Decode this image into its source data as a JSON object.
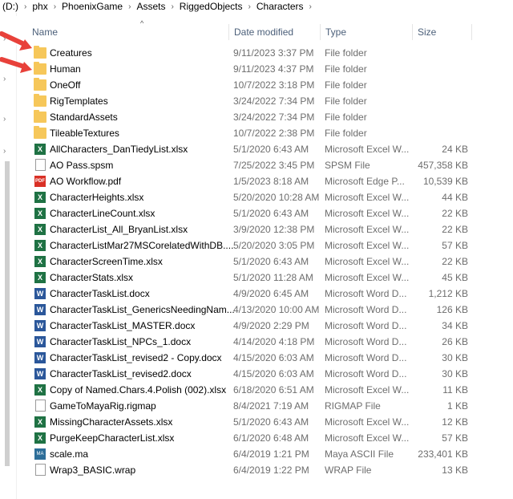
{
  "breadcrumb": [
    "(D:)",
    "phx",
    "PhoenixGame",
    "Assets",
    "RiggedObjects",
    "Characters"
  ],
  "columns": {
    "name": "Name",
    "date": "Date modified",
    "type": "Type",
    "size": "Size"
  },
  "files": [
    {
      "name": "Creatures",
      "date": "9/11/2023 3:37 PM",
      "type": "File folder",
      "size": "",
      "icon": "folder-icon"
    },
    {
      "name": "Human",
      "date": "9/11/2023 4:37 PM",
      "type": "File folder",
      "size": "",
      "icon": "folder-icon"
    },
    {
      "name": "OneOff",
      "date": "10/7/2022 3:18 PM",
      "type": "File folder",
      "size": "",
      "icon": "folder-icon"
    },
    {
      "name": "RigTemplates",
      "date": "3/24/2022 7:34 PM",
      "type": "File folder",
      "size": "",
      "icon": "folder-icon"
    },
    {
      "name": "StandardAssets",
      "date": "3/24/2022 7:34 PM",
      "type": "File folder",
      "size": "",
      "icon": "folder-icon"
    },
    {
      "name": "TileableTextures",
      "date": "10/7/2022 2:38 PM",
      "type": "File folder",
      "size": "",
      "icon": "folder-icon"
    },
    {
      "name": "AllCharacters_DanTiedyList.xlsx",
      "date": "5/1/2020 6:43 AM",
      "type": "Microsoft Excel W...",
      "size": "24 KB",
      "icon": "excel-icon"
    },
    {
      "name": "AO Pass.spsm",
      "date": "7/25/2022 3:45 PM",
      "type": "SPSM File",
      "size": "457,358 KB",
      "icon": "file-icon"
    },
    {
      "name": "AO Workflow.pdf",
      "date": "1/5/2023 8:18 AM",
      "type": "Microsoft Edge P...",
      "size": "10,539 KB",
      "icon": "pdf-icon"
    },
    {
      "name": "CharacterHeights.xlsx",
      "date": "5/20/2020 10:28 AM",
      "type": "Microsoft Excel W...",
      "size": "44 KB",
      "icon": "excel-icon"
    },
    {
      "name": "CharacterLineCount.xlsx",
      "date": "5/1/2020 6:43 AM",
      "type": "Microsoft Excel W...",
      "size": "22 KB",
      "icon": "excel-icon"
    },
    {
      "name": "CharacterList_All_BryanList.xlsx",
      "date": "3/9/2020 12:38 PM",
      "type": "Microsoft Excel W...",
      "size": "22 KB",
      "icon": "excel-icon"
    },
    {
      "name": "CharacterListMar27MSCorelatedWithDB....",
      "date": "5/20/2020 3:05 PM",
      "type": "Microsoft Excel W...",
      "size": "57 KB",
      "icon": "excel-icon"
    },
    {
      "name": "CharacterScreenTime.xlsx",
      "date": "5/1/2020 6:43 AM",
      "type": "Microsoft Excel W...",
      "size": "22 KB",
      "icon": "excel-icon"
    },
    {
      "name": "CharacterStats.xlsx",
      "date": "5/1/2020 11:28 AM",
      "type": "Microsoft Excel W...",
      "size": "45 KB",
      "icon": "excel-icon"
    },
    {
      "name": "CharacterTaskList.docx",
      "date": "4/9/2020 6:45 AM",
      "type": "Microsoft Word D...",
      "size": "1,212 KB",
      "icon": "word-icon"
    },
    {
      "name": "CharacterTaskList_GenericsNeedingNam...",
      "date": "4/13/2020 10:00 AM",
      "type": "Microsoft Word D...",
      "size": "126 KB",
      "icon": "word-icon"
    },
    {
      "name": "CharacterTaskList_MASTER.docx",
      "date": "4/9/2020 2:29 PM",
      "type": "Microsoft Word D...",
      "size": "34 KB",
      "icon": "word-icon"
    },
    {
      "name": "CharacterTaskList_NPCs_1.docx",
      "date": "4/14/2020 4:18 PM",
      "type": "Microsoft Word D...",
      "size": "26 KB",
      "icon": "word-icon"
    },
    {
      "name": "CharacterTaskList_revised2 - Copy.docx",
      "date": "4/15/2020 6:03 AM",
      "type": "Microsoft Word D...",
      "size": "30 KB",
      "icon": "word-icon"
    },
    {
      "name": "CharacterTaskList_revised2.docx",
      "date": "4/15/2020 6:03 AM",
      "type": "Microsoft Word D...",
      "size": "30 KB",
      "icon": "word-icon"
    },
    {
      "name": "Copy of Named.Chars.4.Polish (002).xlsx",
      "date": "6/18/2020 6:51 AM",
      "type": "Microsoft Excel W...",
      "size": "11 KB",
      "icon": "excel-icon"
    },
    {
      "name": "GameToMayaRig.rigmap",
      "date": "8/4/2021 7:19 AM",
      "type": "RIGMAP File",
      "size": "1 KB",
      "icon": "file-icon"
    },
    {
      "name": "MissingCharacterAssets.xlsx",
      "date": "5/1/2020 6:43 AM",
      "type": "Microsoft Excel W...",
      "size": "12 KB",
      "icon": "excel-icon"
    },
    {
      "name": "PurgeKeepCharacterList.xlsx",
      "date": "6/1/2020 6:48 AM",
      "type": "Microsoft Excel W...",
      "size": "57 KB",
      "icon": "excel-icon"
    },
    {
      "name": "scale.ma",
      "date": "6/4/2019 1:21 PM",
      "type": "Maya ASCII File",
      "size": "233,401 KB",
      "icon": "maya-icon"
    },
    {
      "name": "Wrap3_BASIC.wrap",
      "date": "6/4/2019 1:22 PM",
      "type": "WRAP File",
      "size": "13 KB",
      "icon": "file-icon"
    }
  ],
  "icon_labels": {
    "excel-icon": "X",
    "word-icon": "W",
    "pdf-icon": "PDF",
    "maya-icon": "MA"
  },
  "colors": {
    "folder": "#f6c75a",
    "excel": "#1f7244",
    "word": "#2b579a",
    "pdf": "#d93025",
    "arrow": "#e8413a",
    "header_text": "#4c607a"
  }
}
